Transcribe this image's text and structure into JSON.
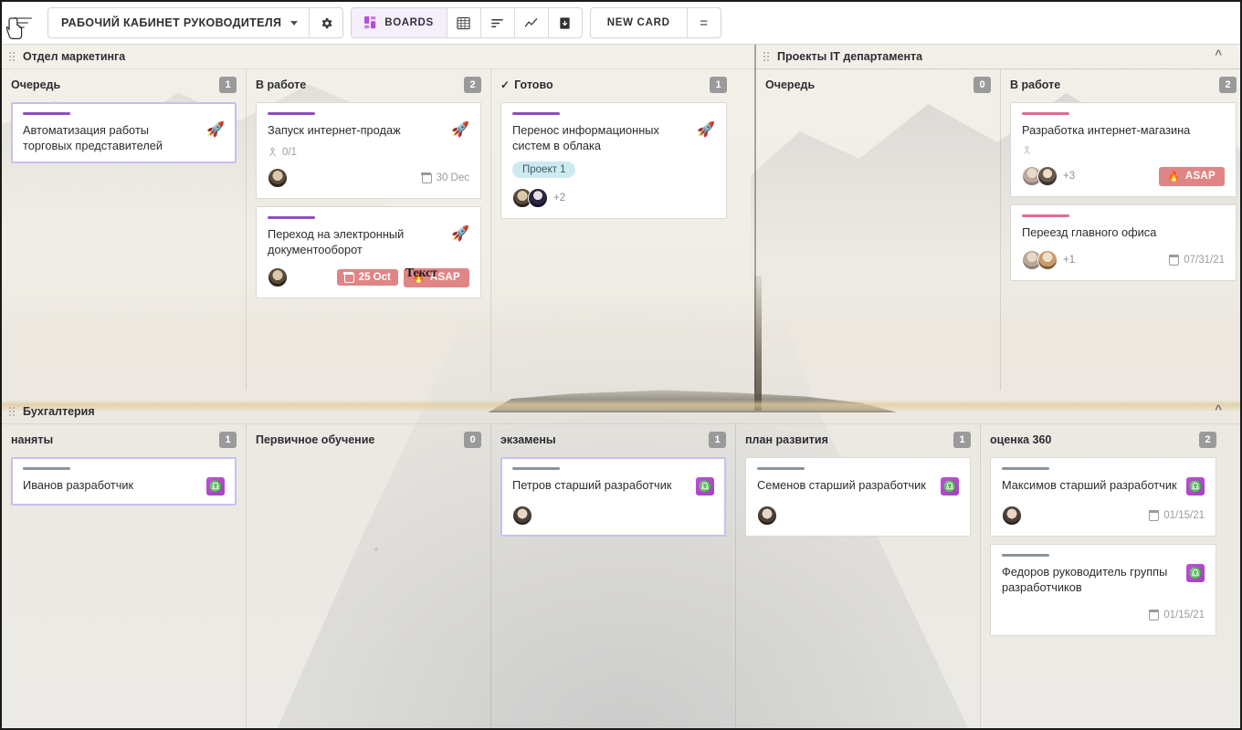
{
  "toolbar": {
    "menu_icon": "hamburger-icon",
    "board_name": "РАБОЧИЙ КАБИНЕТ РУКОВОДИТЕЛЯ",
    "settings_icon": "gear-icon",
    "boards_label": "BOARDS",
    "boards_icon": "grid-blocks-icon",
    "view_table_icon": "table-grid-icon",
    "view_list_icon": "list-sort-icon",
    "view_chart_icon": "line-chart-icon",
    "view_archive_icon": "archive-box-icon",
    "new_card_label": "NEW CARD",
    "more_label": "=",
    "accent_purple": "#a83ec6",
    "accent_pink": "#e08585"
  },
  "swimlanes": [
    {
      "id": "marketing",
      "title": "Отдел маркетинга",
      "collapse_icon": "chevron-up-icon",
      "columns": [
        {
          "title": "Очередь",
          "count": "1",
          "checked": false,
          "cards": [
            {
              "title": "Автоматизация работы торговых представителей",
              "bar": "purple",
              "emoji": "🚀",
              "selected": true,
              "avatars": [],
              "avatars_more": "",
              "date": "",
              "date_due": false,
              "subtask": "",
              "tag": "",
              "asap": false
            }
          ]
        },
        {
          "title": "В работе",
          "count": "2",
          "checked": false,
          "cards": [
            {
              "title": "Запуск интернет-продаж",
              "bar": "purple",
              "emoji": "🚀",
              "selected": false,
              "subtask": "0/1",
              "avatars": [
                "a1"
              ],
              "avatars_more": "",
              "date": "30 Dec",
              "date_due": false,
              "tag": "",
              "asap": false
            },
            {
              "title": "Переход на электронный документооборот",
              "bar": "purple",
              "emoji": "🚀",
              "selected": false,
              "subtask": "",
              "avatars": [
                "a1"
              ],
              "avatars_more": "",
              "date": "25 Oct",
              "date_due": true,
              "tag": "",
              "asap": true,
              "asap_label": "ASAP",
              "overlay_text": "Текст"
            }
          ]
        },
        {
          "title": "Готово",
          "count": "1",
          "checked": true,
          "cards": [
            {
              "title": "Перенос информационных систем в облака",
              "bar": "purple",
              "emoji": "🚀",
              "selected": false,
              "subtask": "",
              "tag": "Проект 1",
              "avatars": [
                "a1",
                "a2"
              ],
              "avatars_more": "+2",
              "date": "",
              "date_due": false,
              "asap": false
            }
          ]
        }
      ]
    },
    {
      "id": "it",
      "title": "Проекты IT департамента",
      "collapse_icon": "",
      "columns": [
        {
          "title": "Очередь",
          "count": "0",
          "checked": false,
          "cards": []
        },
        {
          "title": "В работе",
          "count": "2",
          "checked": false,
          "cards": [
            {
              "title": "Разработка интернет-магазина",
              "bar": "pink",
              "emoji": "",
              "selected": false,
              "subtask": " ",
              "avatars": [
                "a3",
                "a4"
              ],
              "avatars_more": "+3",
              "date": "",
              "date_due": false,
              "tag": "",
              "asap": true,
              "asap_label": "ASAP"
            },
            {
              "title": "Переезд главного офиса",
              "bar": "pink",
              "emoji": "",
              "selected": false,
              "subtask": "",
              "avatars": [
                "a3",
                "a5"
              ],
              "avatars_more": "+1",
              "date": "07/31/21",
              "date_due": false,
              "tag": "",
              "asap": false
            }
          ]
        }
      ]
    },
    {
      "id": "accounting",
      "title": "Бухгалтерия",
      "collapse_icon": "chevron-up-icon",
      "columns": [
        {
          "title": "наняты",
          "count": "1",
          "checked": false,
          "cards": [
            {
              "title": "Иванов разработчик",
              "bar": "grey",
              "hr_badge": "♎",
              "selected": true,
              "avatars": [],
              "avatars_more": "",
              "date": "",
              "date_due": false,
              "subtask": "",
              "tag": "",
              "asap": false
            }
          ]
        },
        {
          "title": "Первичное обучение",
          "count": "0",
          "checked": false,
          "cards": []
        },
        {
          "title": "экзамены",
          "count": "1",
          "checked": false,
          "cards": [
            {
              "title": "Петров старший разработчик",
              "bar": "grey",
              "hr_badge": "♎",
              "selected": true,
              "avatars": [
                "a6"
              ],
              "avatars_more": "",
              "date": "",
              "date_due": false,
              "subtask": "",
              "tag": "",
              "asap": false
            }
          ]
        },
        {
          "title": "план развития",
          "count": "1",
          "checked": false,
          "cards": [
            {
              "title": "Семенов старший разработчик",
              "bar": "grey",
              "hr_badge": "♎",
              "selected": false,
              "avatars": [
                "a6"
              ],
              "avatars_more": "",
              "date": "",
              "date_due": false,
              "subtask": "",
              "tag": "",
              "asap": false
            }
          ]
        },
        {
          "title": "оценка 360",
          "count": "2",
          "checked": false,
          "cards": [
            {
              "title": "Максимов старший разработчик",
              "bar": "grey",
              "hr_badge": "♎",
              "selected": false,
              "avatars": [
                "a6"
              ],
              "avatars_more": "",
              "date": "01/15/21",
              "date_due": false,
              "subtask": "",
              "tag": "",
              "asap": false
            },
            {
              "title": "Федоров руководитель группы разработчиков",
              "bar": "grey",
              "hr_badge": "♎",
              "selected": false,
              "avatars": [],
              "avatars_more": "",
              "date": "01/15/21",
              "date_due": false,
              "subtask": "",
              "tag": "",
              "asap": false
            }
          ]
        }
      ]
    }
  ]
}
